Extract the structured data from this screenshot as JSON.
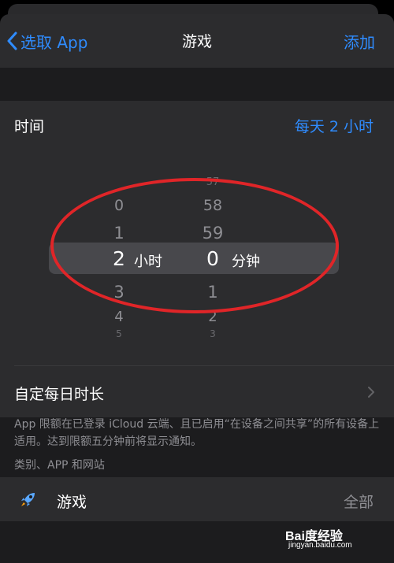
{
  "nav": {
    "back_label": "选取 App",
    "title": "游戏",
    "add_label": "添加"
  },
  "time_row": {
    "label": "时间",
    "value": "每天 2 小时"
  },
  "picker": {
    "hours": [
      "0",
      "1",
      "2",
      "3",
      "4",
      "5"
    ],
    "minutes": [
      "57",
      "58",
      "59",
      "0",
      "1",
      "2",
      "3"
    ],
    "selected_hour": "2",
    "selected_minute": "0",
    "hour_unit": "小时",
    "minute_unit": "分钟"
  },
  "custom_row": {
    "label": "自定每日时长"
  },
  "note": "App 限额在已登录 iCloud 云端、且已启用“在设备之间共享”的所有设备上适用。达到限额五分钟前将显示通知。",
  "section_header": "类别、APP 和网站",
  "games_row": {
    "label": "游戏",
    "value": "全部"
  },
  "watermark": {
    "logo": "Bai度经验",
    "url": "jingyan.baidu.com"
  },
  "colors": {
    "accent": "#2f8cff",
    "annotation": "#e02528",
    "background": "#1c1c1e"
  }
}
